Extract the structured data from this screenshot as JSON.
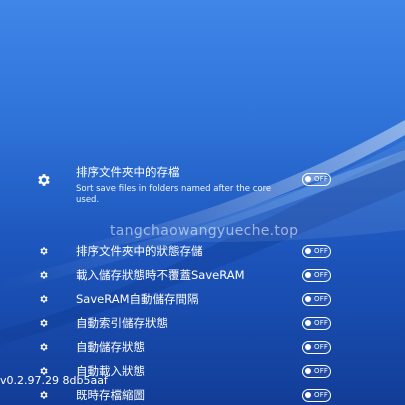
{
  "background": {
    "top_color": "#3f86e8",
    "bottom_color": "#123d98"
  },
  "menu": {
    "items": [
      {
        "label": "排序文件夾中的存檔",
        "sublabel": "Sort save files in folders named after the core used.",
        "toggle": "OFF",
        "icon": "gear-icon"
      },
      {
        "label": "排序文件夾中的狀態存儲",
        "toggle": "OFF",
        "icon": "gear-icon"
      },
      {
        "label": "載入儲存狀態時不覆蓋SaveRAM",
        "toggle": "OFF",
        "icon": "gear-icon"
      },
      {
        "label": "SaveRAM自動儲存間隔",
        "toggle": "OFF",
        "icon": "gear-icon"
      },
      {
        "label": "自動索引儲存狀態",
        "toggle": "OFF",
        "icon": "gear-icon"
      },
      {
        "label": "自動儲存狀態",
        "toggle": "OFF",
        "icon": "gear-icon"
      },
      {
        "label": "自動載入狀態",
        "toggle": "OFF",
        "icon": "gear-icon"
      },
      {
        "label": "既時存檔縮圖",
        "toggle": "OFF",
        "icon": "gear-icon"
      }
    ]
  },
  "watermark": "tangchaowangyueche.top",
  "version": "v0.2.97.29  8db5aaf"
}
